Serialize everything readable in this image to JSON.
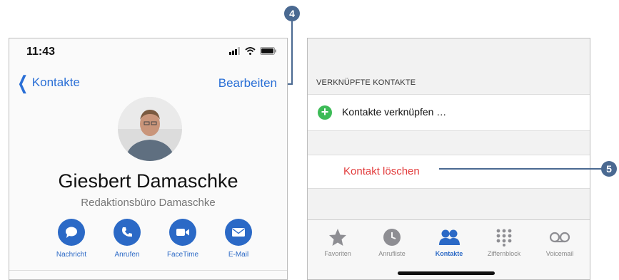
{
  "left": {
    "time": "11:43",
    "back_label": "Kontakte",
    "edit_label": "Bearbeiten",
    "name": "Giesbert Damaschke",
    "company": "Redaktionsbüro Damaschke",
    "actions": [
      {
        "label": "Nachricht",
        "icon": "message-icon"
      },
      {
        "label": "Anrufen",
        "icon": "phone-icon"
      },
      {
        "label": "FaceTime",
        "icon": "video-icon"
      },
      {
        "label": "E-Mail",
        "icon": "mail-icon"
      }
    ]
  },
  "right": {
    "section_header": "VERKNÜPFTE KONTAKTE",
    "link_label": "Kontakte verknüpfen …",
    "delete_label": "Kontakt löschen",
    "tabs": [
      {
        "label": "Favoriten",
        "icon": "star-icon"
      },
      {
        "label": "Anrufliste",
        "icon": "clock-icon"
      },
      {
        "label": "Kontakte",
        "icon": "contacts-icon",
        "active": true
      },
      {
        "label": "Ziffernblock",
        "icon": "keypad-icon"
      },
      {
        "label": "Voicemail",
        "icon": "voicemail-icon"
      }
    ]
  },
  "callouts": [
    "4",
    "5"
  ],
  "colors": {
    "accent": "#2b69c6",
    "delete": "#e23c3c",
    "link_plus": "#3dbb57",
    "callout": "#4a6991"
  }
}
